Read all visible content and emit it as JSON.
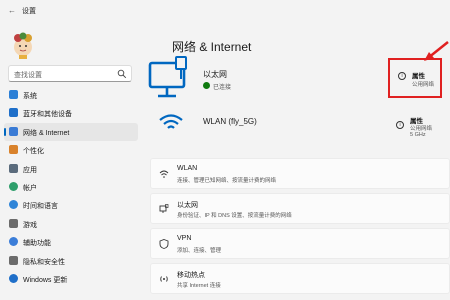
{
  "window": {
    "title": "设置"
  },
  "sidebar": {
    "search_placeholder": "查找设置",
    "items": [
      {
        "label": "系统",
        "icon": "monitor-icon",
        "color": "#2b7fd6"
      },
      {
        "label": "蓝牙和其他设备",
        "icon": "bluetooth-icon",
        "color": "#1f6fc9"
      },
      {
        "label": "网络 & Internet",
        "icon": "network-icon",
        "color": "#3a7bd5",
        "selected": true
      },
      {
        "label": "个性化",
        "icon": "brush-icon",
        "color": "#d9822b"
      },
      {
        "label": "应用",
        "icon": "apps-icon",
        "color": "#5a6b7c"
      },
      {
        "label": "帐户",
        "icon": "account-icon",
        "color": "#2e9e6b"
      },
      {
        "label": "时间和语言",
        "icon": "globe-icon",
        "color": "#2f85d8"
      },
      {
        "label": "游戏",
        "icon": "gamepad-icon",
        "color": "#6b6b6b"
      },
      {
        "label": "辅助功能",
        "icon": "accessibility-icon",
        "color": "#3b7dd8"
      },
      {
        "label": "隐私和安全性",
        "icon": "shield-icon",
        "color": "#6b6b6b"
      },
      {
        "label": "Windows 更新",
        "icon": "update-icon",
        "color": "#1f6fc9"
      }
    ]
  },
  "main": {
    "title": "网络 & Internet",
    "ethernet": {
      "name": "以太网",
      "status": "已连接",
      "properties_title": "属性",
      "properties_sub": "公用网络"
    },
    "wlan": {
      "name": "WLAN (fly_5G)",
      "properties_title": "属性",
      "properties_sub1": "公用网络",
      "properties_sub2": "5 GHz"
    },
    "cards": [
      {
        "title": "WLAN",
        "desc": "连接、管理已知网络、按流量计费的网络",
        "icon": "wifi-icon"
      },
      {
        "title": "以太网",
        "desc": "身份验证、IP 和 DNS 设置、按流量计费的网络",
        "icon": "ethernet-icon"
      },
      {
        "title": "VPN",
        "desc": "添加、连接、管理",
        "icon": "vpn-shield-icon"
      },
      {
        "title": "移动热点",
        "desc": "共享 Internet 连接",
        "icon": "hotspot-icon"
      }
    ]
  },
  "colors": {
    "accent": "#0067c0",
    "highlight": "#e02020",
    "connected": "#0f7b0f"
  }
}
